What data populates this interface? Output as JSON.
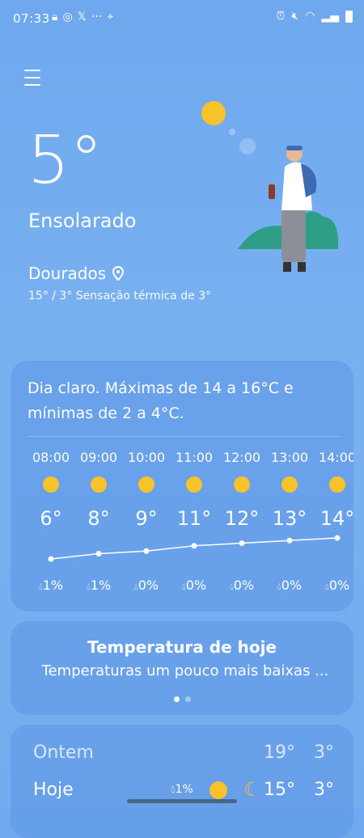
{
  "status": {
    "time": "07:33"
  },
  "current": {
    "temperature": "5°",
    "condition": "Ensolarado",
    "location": "Dourados",
    "range_feels": "15° / 3° Sensação térmica de 3°"
  },
  "forecast_card": {
    "summary": "Dia claro. Máximas de 14 a 16°C e mínimas de 2 a 4°C.",
    "hours": [
      {
        "time": "08:00",
        "temp": "6°",
        "rain": "1%",
        "value": 6
      },
      {
        "time": "09:00",
        "temp": "8°",
        "rain": "1%",
        "value": 8
      },
      {
        "time": "10:00",
        "temp": "9°",
        "rain": "0%",
        "value": 9
      },
      {
        "time": "11:00",
        "temp": "11°",
        "rain": "0%",
        "value": 11
      },
      {
        "time": "12:00",
        "temp": "12°",
        "rain": "0%",
        "value": 12
      },
      {
        "time": "13:00",
        "temp": "13°",
        "rain": "0%",
        "value": 13
      },
      {
        "time": "14:00",
        "temp": "14°",
        "rain": "0%",
        "value": 14
      }
    ]
  },
  "today_card": {
    "title": "Temperatura de hoje",
    "subtitle": "Temperaturas um pouco mais baixas ..."
  },
  "daily": [
    {
      "day": "Ontem",
      "high": "19°",
      "low": "3°"
    },
    {
      "day": "Hoje",
      "rain": "1%",
      "high": "15°",
      "low": "3°"
    }
  ],
  "colors": {
    "sun": "#f8c22a",
    "background": "#74adee"
  }
}
